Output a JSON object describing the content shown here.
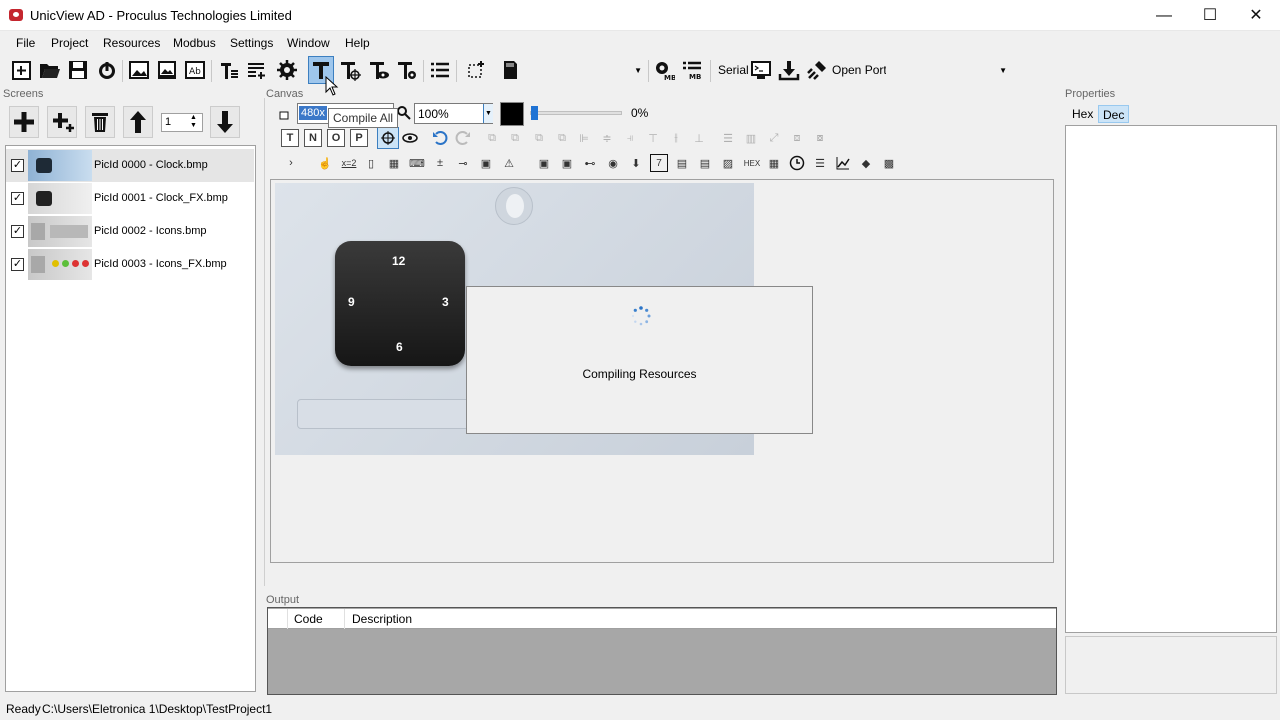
{
  "window": {
    "title": "UnicView AD - Proculus Technologies Limited",
    "minimize": "—",
    "maximize": "☐",
    "close": "✕"
  },
  "menu": [
    "File",
    "Project",
    "Resources",
    "Modbus",
    "Settings",
    "Window",
    "Help"
  ],
  "toolbar": {
    "combo_value": "",
    "serial_label": "Serial",
    "open_port_label": "Open Port",
    "port_value": "",
    "tooltip": "Compile All"
  },
  "screens": {
    "panel_label": "Screens",
    "page_value": "1",
    "items": [
      {
        "label": "PicId 0000 - Clock.bmp",
        "checked": true
      },
      {
        "label": "PicId 0001 - Clock_FX.bmp",
        "checked": true
      },
      {
        "label": "PicId 0002 - Icons.bmp",
        "checked": true
      },
      {
        "label": "PicId 0003 - Icons_FX.bmp",
        "checked": true
      }
    ]
  },
  "canvas": {
    "panel_label": "Canvas",
    "resolution": "480x",
    "zoom": "100%",
    "opacity_label": "0%",
    "opacity_level": 0,
    "format_letters": [
      "T",
      "N",
      "O",
      "P"
    ],
    "clock_numbers": {
      "top": "12",
      "left": "9",
      "right": "3",
      "bottom": "6"
    }
  },
  "dialog": {
    "message": "Compiling Resources"
  },
  "properties": {
    "panel_label": "Properties",
    "hex_tab": "Hex",
    "dec_tab": "Dec"
  },
  "output": {
    "panel_label": "Output",
    "columns": [
      "Code",
      "Description"
    ]
  },
  "status": {
    "state": "Ready",
    "path": "C:\\Users\\Eletronica 1\\Desktop\\TestProject1"
  },
  "colors": {
    "selection": "#9ec6ec",
    "accent_blue": "#2b74c7",
    "panel_gray": "#a7a7a7"
  }
}
